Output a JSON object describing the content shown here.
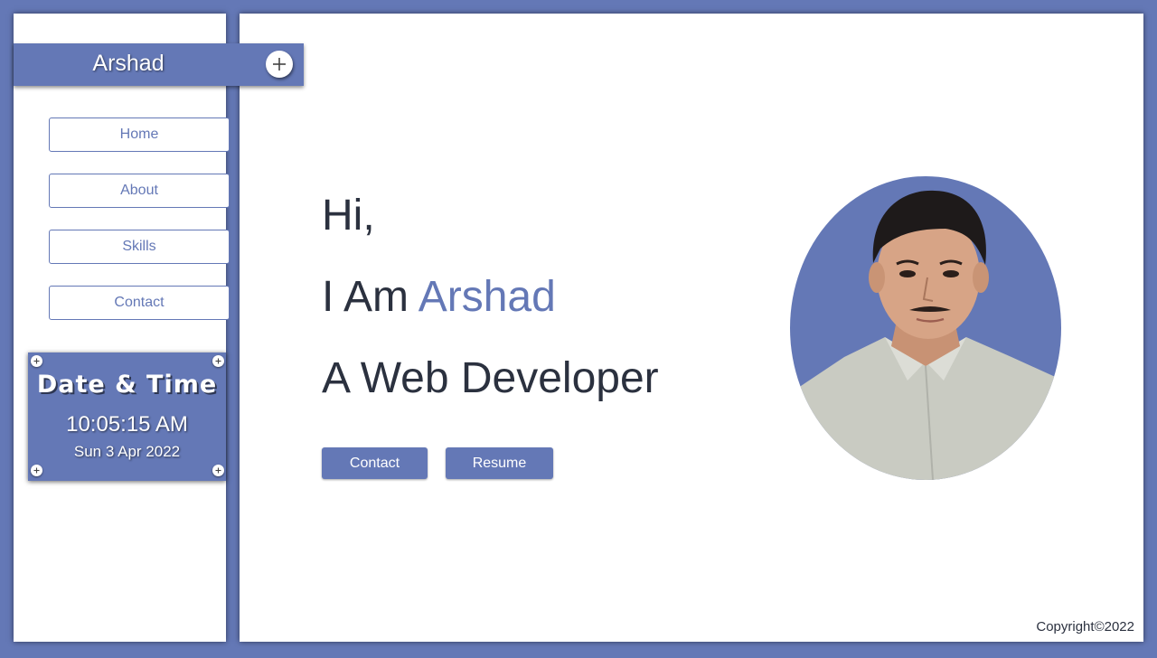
{
  "colors": {
    "accent": "#6478b6",
    "text_dark": "#2b313f",
    "panel": "#ffffff"
  },
  "sidebar": {
    "brand": "Arshad",
    "toggle_icon": "plus-icon",
    "nav": [
      {
        "label": "Home"
      },
      {
        "label": "About"
      },
      {
        "label": "Skills"
      },
      {
        "label": "Contact"
      }
    ],
    "datetime": {
      "title": "Date & Time",
      "time": "10:05:15 AM",
      "date": "Sun 3 Apr 2022",
      "corner_icon": "plus-icon"
    }
  },
  "hero": {
    "greeting": "Hi,",
    "intro_prefix": "I Am",
    "name": "Arshad",
    "role": "A Web Developer",
    "buttons": {
      "contact": "Contact",
      "resume": "Resume"
    },
    "portrait": "profile-photo"
  },
  "footer": {
    "copyright": "Copyright©2022"
  }
}
